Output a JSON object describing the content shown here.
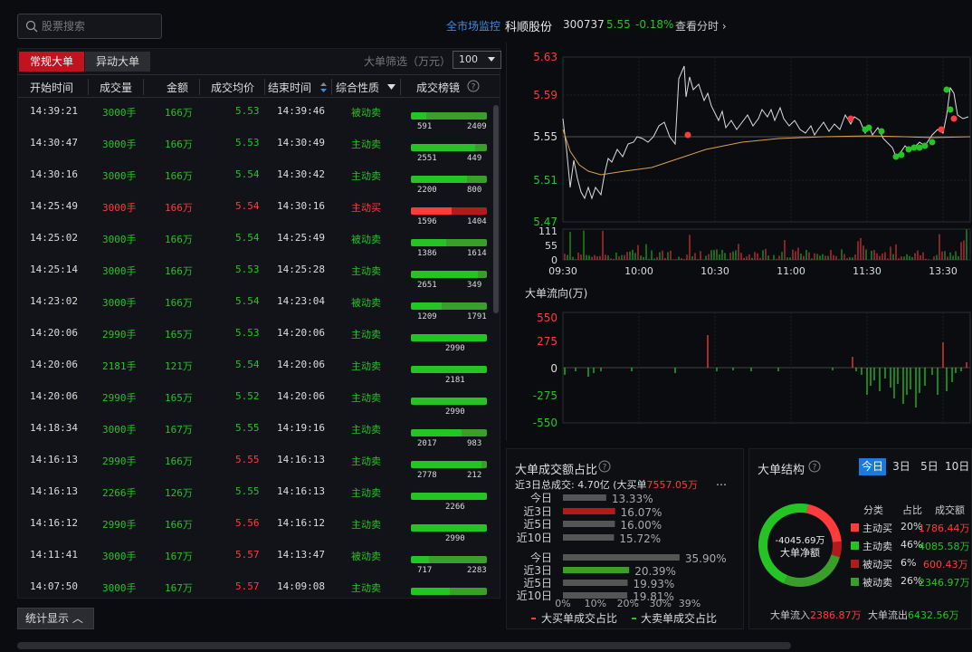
{
  "search": {
    "placeholder": "股票搜索"
  },
  "header": {
    "monitor_link": "全市场监控",
    "stock_name": "科顺股份",
    "stock_code": "300737",
    "price": "5.55",
    "change": "-0.18%",
    "view_intraday": "查看分时"
  },
  "tabs": [
    {
      "label": "常规大单",
      "active": true
    },
    {
      "label": "异动大单",
      "active": false
    }
  ],
  "filter": {
    "label": "大单筛选（万元）",
    "value": "100"
  },
  "columns": [
    "开始时间",
    "成交量",
    "金额",
    "成交均价",
    "结束时间",
    "综合性质",
    "成交榜镜"
  ],
  "rows": [
    {
      "start": "14:39:21",
      "vol": "3000手",
      "amt": "166万",
      "avg": "5.53",
      "end": "14:39:46",
      "nature": "被动卖",
      "color": "green",
      "buy": 591,
      "sell": 2409,
      "buy_label": "591",
      "sell_label": "2409"
    },
    {
      "start": "14:30:47",
      "vol": "3000手",
      "amt": "166万",
      "avg": "5.53",
      "end": "14:30:49",
      "nature": "主动卖",
      "color": "green",
      "buy": 2551,
      "sell": 449,
      "buy_label": "2551",
      "sell_label": "449"
    },
    {
      "start": "14:30:16",
      "vol": "3000手",
      "amt": "166万",
      "avg": "5.54",
      "end": "14:30:42",
      "nature": "主动卖",
      "color": "green",
      "buy": 2200,
      "sell": 800,
      "buy_label": "2200",
      "sell_label": "800"
    },
    {
      "start": "14:25:49",
      "vol": "3000手",
      "amt": "166万",
      "avg": "5.54",
      "end": "14:30:16",
      "nature": "主动买",
      "color": "red",
      "buy": 1596,
      "sell": 1404,
      "buy_label": "1596",
      "sell_label": "1404"
    },
    {
      "start": "14:25:02",
      "vol": "3000手",
      "amt": "166万",
      "avg": "5.54",
      "end": "14:25:49",
      "nature": "被动卖",
      "color": "green",
      "buy": 1386,
      "sell": 1614,
      "buy_label": "1386",
      "sell_label": "1614"
    },
    {
      "start": "14:25:14",
      "vol": "3000手",
      "amt": "166万",
      "avg": "5.53",
      "end": "14:25:28",
      "nature": "主动卖",
      "color": "green",
      "buy": 2651,
      "sell": 349,
      "buy_label": "2651",
      "sell_label": "349"
    },
    {
      "start": "14:23:02",
      "vol": "3000手",
      "amt": "166万",
      "avg": "5.54",
      "end": "14:23:04",
      "nature": "被动卖",
      "color": "green",
      "buy": 1209,
      "sell": 1791,
      "buy_label": "1209",
      "sell_label": "1791"
    },
    {
      "start": "14:20:06",
      "vol": "2990手",
      "amt": "165万",
      "avg": "5.53",
      "end": "14:20:06",
      "nature": "主动卖",
      "color": "green",
      "buy": 2990,
      "sell": 0,
      "buy_label": "2990",
      "sell_label": ""
    },
    {
      "start": "14:20:06",
      "vol": "2181手",
      "amt": "121万",
      "avg": "5.54",
      "end": "14:20:06",
      "nature": "主动卖",
      "color": "green",
      "buy": 2181,
      "sell": 0,
      "buy_label": "2181",
      "sell_label": ""
    },
    {
      "start": "14:20:06",
      "vol": "2990手",
      "amt": "165万",
      "avg": "5.52",
      "end": "14:20:06",
      "nature": "主动卖",
      "color": "green",
      "buy": 2990,
      "sell": 0,
      "buy_label": "2990",
      "sell_label": ""
    },
    {
      "start": "14:18:34",
      "vol": "3000手",
      "amt": "167万",
      "avg": "5.55",
      "end": "14:19:16",
      "nature": "主动卖",
      "color": "green",
      "buy": 2017,
      "sell": 983,
      "buy_label": "2017",
      "sell_label": "983"
    },
    {
      "start": "14:16:13",
      "vol": "2990手",
      "amt": "166万",
      "avg": "5.55",
      "end": "14:16:13",
      "nature": "主动卖",
      "color": "green",
      "avg_red": true,
      "buy": 2778,
      "sell": 212,
      "buy_label": "2778",
      "sell_label": "212"
    },
    {
      "start": "14:16:13",
      "vol": "2266手",
      "amt": "126万",
      "avg": "5.55",
      "end": "14:16:13",
      "nature": "主动卖",
      "color": "green",
      "buy": 2266,
      "sell": 0,
      "buy_label": "2266",
      "sell_label": ""
    },
    {
      "start": "14:16:12",
      "vol": "2990手",
      "amt": "166万",
      "avg": "5.56",
      "end": "14:16:12",
      "nature": "主动卖",
      "color": "green",
      "avg_red": true,
      "buy": 2990,
      "sell": 0,
      "buy_label": "2990",
      "sell_label": ""
    },
    {
      "start": "14:11:41",
      "vol": "3000手",
      "amt": "167万",
      "avg": "5.57",
      "end": "14:13:47",
      "nature": "被动卖",
      "color": "green",
      "avg_red": true,
      "buy": 717,
      "sell": 2283,
      "buy_label": "717",
      "sell_label": "2283"
    },
    {
      "start": "14:07:50",
      "vol": "3000手",
      "amt": "167万",
      "avg": "5.57",
      "end": "14:09:08",
      "nature": "主动卖",
      "color": "green",
      "avg_red": true,
      "buy": 1550,
      "sell": 1450,
      "buy_label": "",
      "sell_label": ""
    }
  ],
  "bottom_button": "统计显示",
  "price_chart": {
    "y_labels": [
      "5.63",
      "5.59",
      "5.55",
      "5.51",
      "5.47"
    ],
    "vol_labels": [
      "111",
      "55",
      "0"
    ],
    "x_labels": [
      "09:30",
      "10:00",
      "10:30",
      "11:00",
      "11:30",
      "13:30"
    ]
  },
  "flow_chart": {
    "title": "大单流向(万)",
    "y_labels": [
      "550",
      "275",
      "0",
      "-275",
      "-550"
    ]
  },
  "ratio_panel": {
    "title": "大单成交额占比",
    "summary_prefix": "近3日总成交: 4.70亿 (大买单",
    "summary_value": "7557.05万",
    "more": "…",
    "buy_rows": [
      {
        "label": "今日",
        "pct": "13.33%",
        "v": 13.33
      },
      {
        "label": "近3日",
        "pct": "16.07%",
        "v": 16.07
      },
      {
        "label": "近5日",
        "pct": "16.00%",
        "v": 16.0
      },
      {
        "label": "近10日",
        "pct": "15.72%",
        "v": 15.72
      }
    ],
    "sell_rows": [
      {
        "label": "今日",
        "pct": "35.90%",
        "v": 35.9
      },
      {
        "label": "近3日",
        "pct": "20.39%",
        "v": 20.39
      },
      {
        "label": "近5日",
        "pct": "19.93%",
        "v": 19.93
      },
      {
        "label": "近10日",
        "pct": "19.81%",
        "v": 19.81
      }
    ],
    "axis": [
      "0%",
      "10%",
      "20%",
      "30%",
      "39%"
    ],
    "legend_buy": "大买单成交占比",
    "legend_sell": "大卖单成交占比"
  },
  "structure_panel": {
    "title": "大单结构",
    "periods": [
      "今日",
      "3日",
      "5日",
      "10日"
    ],
    "donut_value": "-4045.69万",
    "donut_label": "大单净额",
    "cols": [
      "分类",
      "占比",
      "成交额"
    ],
    "items": [
      {
        "name": "主动买",
        "pct": "20%",
        "amt": "1786.44万",
        "color": "#ff3b3b"
      },
      {
        "name": "主动卖",
        "pct": "46%",
        "amt": "4085.58万",
        "color": "#23c423"
      },
      {
        "name": "被动买",
        "pct": "6%",
        "amt": "600.43万",
        "color": "#b01c1c"
      },
      {
        "name": "被动卖",
        "pct": "26%",
        "amt": "2346.97万",
        "color": "#3a9e2a"
      }
    ],
    "inflow_label": "大单流入",
    "inflow": "2386.87万",
    "outflow_label": "大单流出",
    "outflow": "6432.56万"
  },
  "colors": {
    "red": "#ff3b3b",
    "green": "#23c423",
    "dark_red": "#b01c1c",
    "dark_green": "#3a9e2a",
    "avg_line": "#d9a050"
  }
}
